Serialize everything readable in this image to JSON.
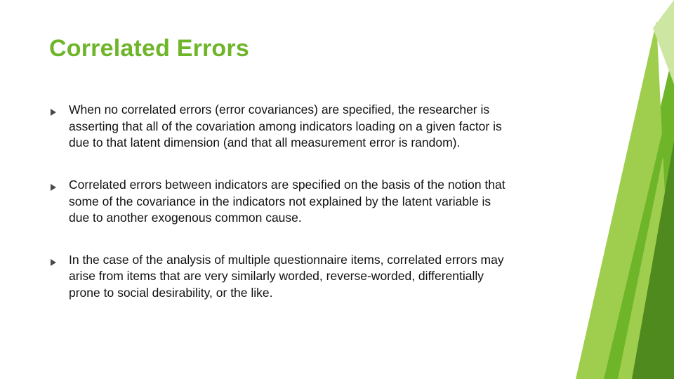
{
  "title": "Correlated Errors",
  "bullets": [
    "When no correlated errors (error covariances) are specified, the researcher is asserting that all of the covariation among indicators loading on a given factor is due to that latent dimension (and that all measurement error is random).",
    "Correlated errors between indicators are specified on the basis of the notion that some of the covariance in the indicators not explained by the latent variable is due to another exogenous common cause.",
    "In the case of the analysis of multiple questionnaire items, correlated errors may arise from items that are very similarly worded, reverse-worded, differentially prone to social desirability, or the like."
  ],
  "colors": {
    "accent": "#6eb52a",
    "accentLight": "#9fce4e",
    "accentDark": "#4f8a1e",
    "arrow": "#4a4a4a"
  }
}
